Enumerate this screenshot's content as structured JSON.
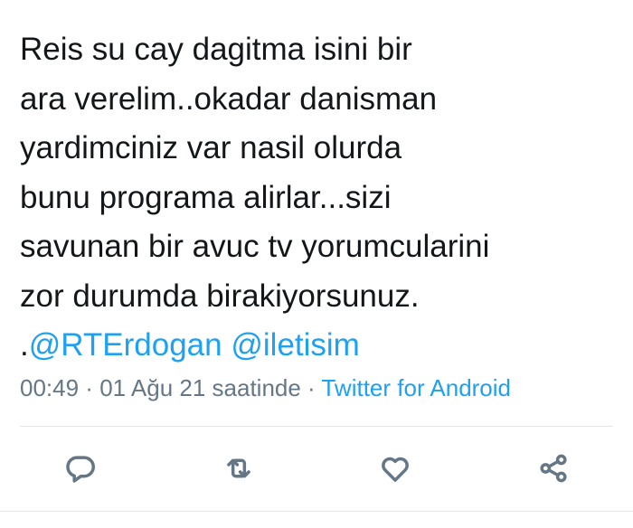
{
  "tweet": {
    "lines": [
      "Reis su cay dagitma isini bir",
      "ara verelim..okadar danisman",
      "yardimciniz var nasil olurda",
      "bunu programa alirlar...sizi",
      "savunan bir avuc tv yorumcularini",
      "zor durumda birakiyorsunuz."
    ],
    "mention_prefix": ".",
    "mention_1": "@RTErdogan",
    "mention_2": "@iletisim"
  },
  "meta": {
    "time": "00:49",
    "separator_1": " · ",
    "date": "01 Ağu 21 saatinde",
    "separator_2": " · ",
    "source": "Twitter for Android"
  },
  "actions": {
    "reply_icon": "reply-icon",
    "retweet_icon": "retweet-icon",
    "like_icon": "heart-icon",
    "share_icon": "share-icon"
  },
  "colors": {
    "text": "#14171a",
    "link": "#1da1f2",
    "muted": "#657786",
    "divider": "#e1e8ed"
  }
}
